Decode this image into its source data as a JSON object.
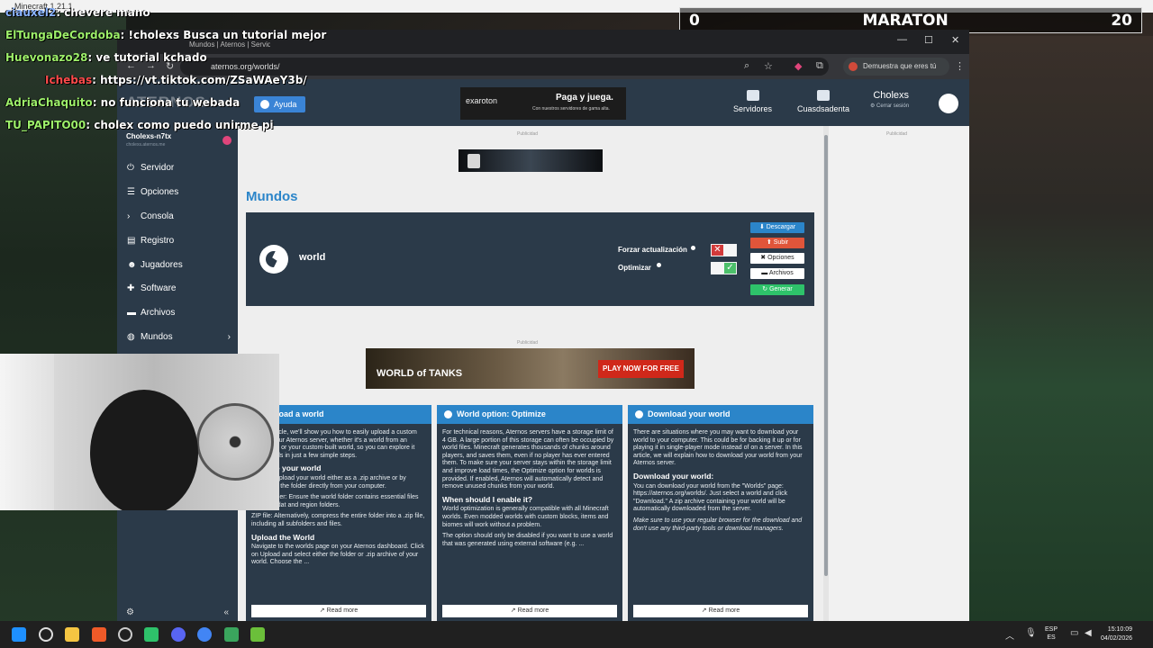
{
  "minecraft_title": "Minecraft 1.21.1",
  "scoreboard": {
    "left": "0",
    "title": "MARATON",
    "right": "20"
  },
  "chat": [
    {
      "user": "ciauxel2",
      "msg": ": chevere mano"
    },
    {
      "user": "ElTungaDeCordoba",
      "msg": ": !cholexs Busca un tutorial mejor"
    },
    {
      "user": "Huevonazo28",
      "msg": ": ve tutorial kchado"
    },
    {
      "user": "",
      "msg": ": https://vt.tiktok.com/ZSaWAeY3b/"
    },
    {
      "user": "Ichebas",
      "msg": ": https://vt.tiktok.com/ZSaWAeY3b/"
    },
    {
      "user": "AdriaChaquito",
      "msg": ": no funciona tu webada"
    },
    {
      "user": "TU_PAPITO00",
      "msg": ": cholex como puedo unirme pi"
    }
  ],
  "browser": {
    "tab_title": "Mundos | Aternos | Servidor d",
    "url": "aternos.org/worlds/",
    "human_button": "Demuestra que eres tú"
  },
  "header": {
    "logo": "ATERNOS",
    "help": "Ayuda",
    "ad_brand": "exaroton",
    "ad_slogan": "Paga y juega.",
    "ad_sub": "Con nuestros servidores de gama alta.",
    "nav_servers": "Servidores",
    "nav_account": "Cuasdsadenta",
    "user_name": "Cholexs",
    "logout": "Cerrar sesión"
  },
  "sidebar": {
    "server_name": "Cholexs-n7tx",
    "server_sub": "cholexs.aternos.me",
    "items": [
      {
        "label": "Servidor",
        "icon": "power-icon"
      },
      {
        "label": "Opciones",
        "icon": "sliders-icon"
      },
      {
        "label": "Consola",
        "icon": "terminal-icon"
      },
      {
        "label": "Registro",
        "icon": "document-icon"
      },
      {
        "label": "Jugadores",
        "icon": "users-icon"
      },
      {
        "label": "Software",
        "icon": "puzzle-icon"
      },
      {
        "label": "Archivos",
        "icon": "folder-icon"
      },
      {
        "label": "Mundos",
        "icon": "globe-icon"
      }
    ]
  },
  "main": {
    "publicidad": "Publicidad",
    "title": "Mundos",
    "world": {
      "name": "world",
      "force_update": "Forzar actualización",
      "optimize": "Optimizar",
      "btn_download": "Descargar",
      "btn_upload": "Subir",
      "btn_options": "Opciones",
      "btn_files": "Archivos",
      "btn_generate": "Generar"
    },
    "wot_logo": "WORLD of TANKS",
    "wot_cta": "PLAY NOW FOR FREE"
  },
  "articles": [
    {
      "title": "Upload a world",
      "p1": "In this article, we'll show you how to easily upload a custom map to your Aternos server, whether it's a world from an adventure or your custom-built world, so you can explore it with friends in just a few simple steps.",
      "h1": "Prepare your world",
      "p2": "You can upload your world either as a .zip archive or by uploading the folder directly from your computer.",
      "p3": "World folder: Ensure the world folder contains essential files like level.dat and region folders.",
      "p4": "ZIP file: Alternatively, compress the entire folder into a .zip file, including all subfolders and files.",
      "h2": "Upload the World",
      "p5": "Navigate to the worlds page on your Aternos dashboard. Click on Upload and select either the folder or .zip archive of your world. Choose the ...",
      "more": "Read more"
    },
    {
      "title": "World option: Optimize",
      "p1": "For technical reasons, Aternos servers have a storage limit of 4 GB. A large portion of this storage can often be occupied by world files. Minecraft generates thousands of chunks around players, and saves them, even if no player has ever entered them. To make sure your server stays within the storage limit and improve load times, the Optimize option for worlds is provided. If enabled, Aternos will automatically detect and remove unused chunks from your world.",
      "h1": "When should I enable it?",
      "p2": "World optimization is generally compatible with all Minecraft worlds. Even modded worlds with custom blocks, items and biomes will work without a problem.",
      "p3": "The option should only be disabled if you want to use a world that was generated using external software (e.g. ...",
      "more": "Read more"
    },
    {
      "title": "Download your world",
      "p1": "There are situations where you may want to download your world to your computer. This could be for backing it up or for playing it in single-player mode instead of on a server. In this article, we will explain how to download your world from your Aternos server.",
      "h1": "Download your world:",
      "p2": "You can download your world from the \"Worlds\" page: https://aternos.org/worlds/. Just select a world and click \"Download.\" A zip archive containing your world will be automatically downloaded from the server.",
      "p3": "Make sure to use your regular browser for the download and don't use any third-party tools or download managers.",
      "more": "Read more"
    }
  ],
  "taskbar": {
    "lang1": "ESP",
    "lang2": "ES",
    "time": "15:10:09",
    "date": "04/02/2026"
  }
}
